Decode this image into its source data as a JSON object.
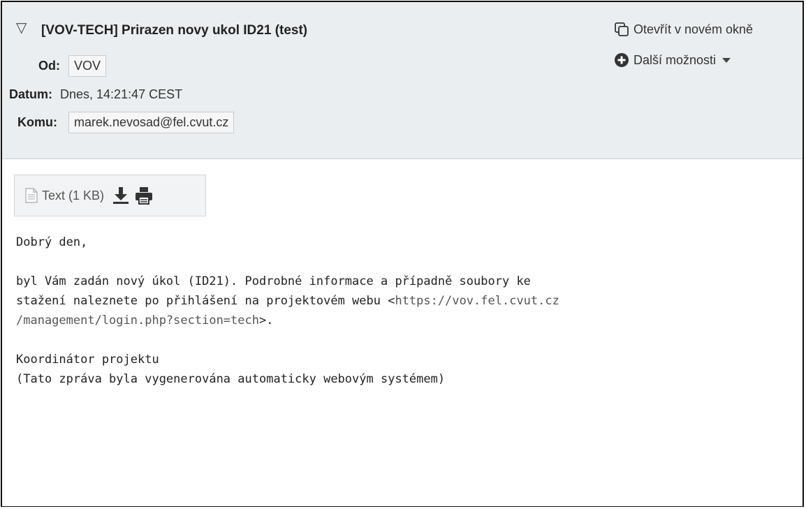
{
  "header": {
    "subject": "[VOV-TECH] Prirazen novy ukol ID21 (test)",
    "from_label": "Od:",
    "from_value": "VOV",
    "date_label": "Datum:",
    "date_value": "Dnes, 14:21:47 CEST",
    "to_label": "Komu:",
    "to_value": "marek.nevosad@fel.cvut.cz",
    "open_new_window": "Otevřít v novém okně",
    "more_options": "Další možnosti"
  },
  "attachment": {
    "label": "Text (1 KB)"
  },
  "message": {
    "greeting": "Dobrý den,",
    "line1": "byl Vám zadán nový úkol (ID21). Podrobné informace a případně soubory ke",
    "line2_text": "stažení naleznete po přihlášení na projektovém webu <",
    "line2_link": "https://vov.fel.cvut.cz",
    "line3_link": "/management/login.php?section=tech",
    "line3_end": ">.",
    "signature1": "Koordinátor projektu",
    "signature2": "(Tato zpráva byla vygenerována automaticky webovým systémem)"
  }
}
